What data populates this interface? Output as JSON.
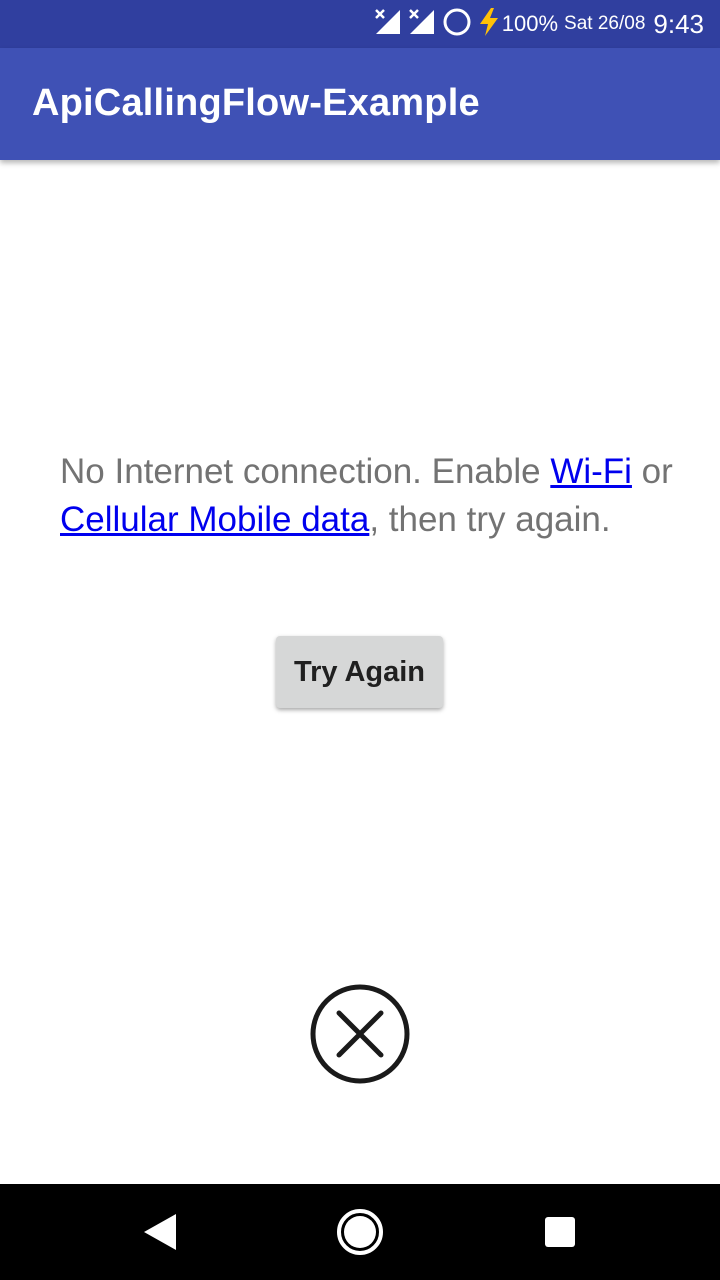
{
  "status_bar": {
    "battery_percent": "100%",
    "date": "Sat 26/08",
    "time": "9:43",
    "icons": [
      "signal-off-icon",
      "signal-off-icon",
      "circle-icon",
      "charging-bolt-icon"
    ]
  },
  "app_bar": {
    "title": "ApiCallingFlow-Example",
    "color": "#3f51b5"
  },
  "message": {
    "part1": "No Internet connection. Enable ",
    "wifi_link": "Wi-Fi",
    "part2": " or ",
    "cellular_link": "Cellular Mobile data",
    "part3": ", then try again."
  },
  "try_again_button": {
    "label": "Try Again"
  },
  "close_icon": "close-circle-icon",
  "nav_bar": {
    "buttons": [
      "back-icon",
      "home-icon",
      "recents-icon"
    ]
  }
}
